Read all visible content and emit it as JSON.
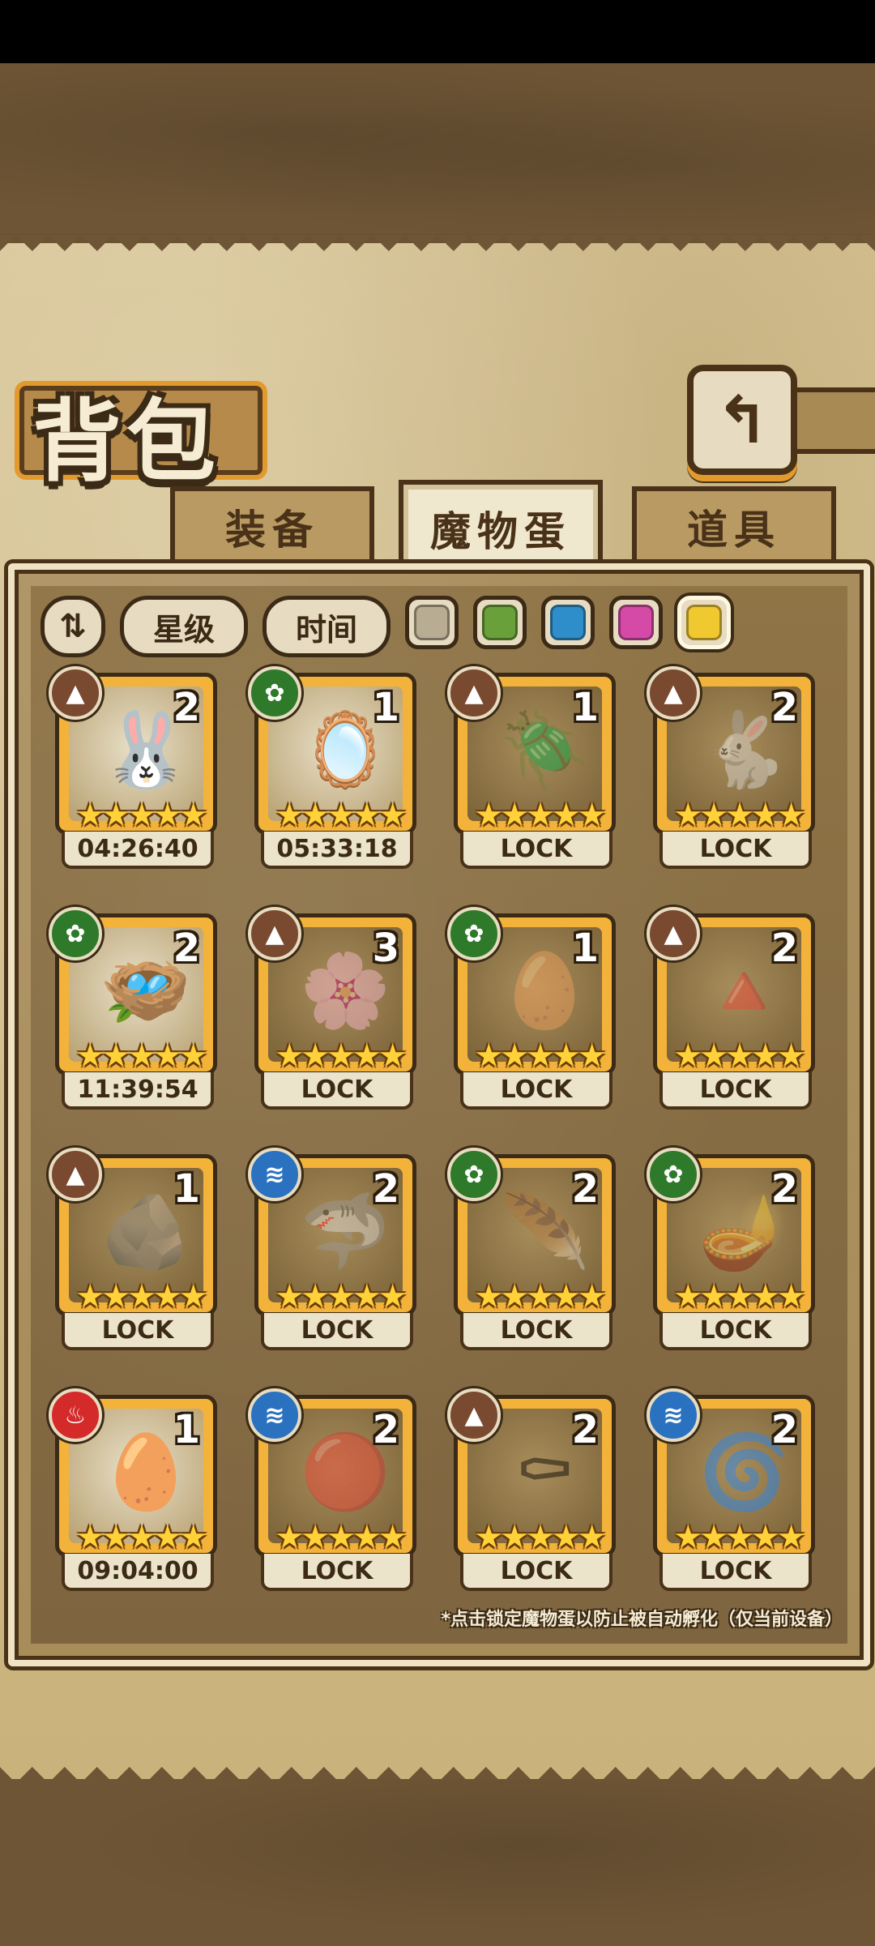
{
  "header": {
    "title": "背包",
    "back_icon": "↰"
  },
  "tabs": [
    {
      "label": "装备",
      "active": false
    },
    {
      "label": "魔物蛋",
      "active": true
    },
    {
      "label": "道具",
      "active": false
    }
  ],
  "filters": {
    "sort_icon": "⇅",
    "star_label": "星级",
    "time_label": "时间",
    "colors": [
      "#b8ad93",
      "#6aa03a",
      "#2e8ec9",
      "#d44aa6",
      "#f0c830"
    ]
  },
  "stars": "★★★★★",
  "eggs": [
    {
      "element": "earth",
      "count": "2",
      "label": "04:26:40",
      "glyph": "🐰",
      "locked": false
    },
    {
      "element": "wood",
      "count": "1",
      "label": "05:33:18",
      "glyph": "🪞",
      "locked": false
    },
    {
      "element": "earth",
      "count": "1",
      "label": "LOCK",
      "glyph": "🪲",
      "locked": true
    },
    {
      "element": "earth",
      "count": "2",
      "label": "LOCK",
      "glyph": "🐇",
      "locked": true
    },
    {
      "element": "wood",
      "count": "2",
      "label": "11:39:54",
      "glyph": "🪺",
      "locked": false
    },
    {
      "element": "earth",
      "count": "3",
      "label": "LOCK",
      "glyph": "🌸",
      "locked": true
    },
    {
      "element": "wood",
      "count": "1",
      "label": "LOCK",
      "glyph": "🥚",
      "locked": true
    },
    {
      "element": "earth",
      "count": "2",
      "label": "LOCK",
      "glyph": "🔺",
      "locked": true
    },
    {
      "element": "earth",
      "count": "1",
      "label": "LOCK",
      "glyph": "🪨",
      "locked": true
    },
    {
      "element": "water",
      "count": "2",
      "label": "LOCK",
      "glyph": "🦈",
      "locked": true
    },
    {
      "element": "wood",
      "count": "2",
      "label": "LOCK",
      "glyph": "🪶",
      "locked": true
    },
    {
      "element": "wood",
      "count": "2",
      "label": "LOCK",
      "glyph": "🪔",
      "locked": true
    },
    {
      "element": "fire",
      "count": "1",
      "label": "09:04:00",
      "glyph": "🥚",
      "locked": false
    },
    {
      "element": "water",
      "count": "2",
      "label": "LOCK",
      "glyph": "🔴",
      "locked": true
    },
    {
      "element": "earth",
      "count": "2",
      "label": "LOCK",
      "glyph": "⚰",
      "locked": true
    },
    {
      "element": "water",
      "count": "2",
      "label": "LOCK",
      "glyph": "🌀",
      "locked": true
    }
  ],
  "element_icons": {
    "earth": "▲",
    "wood": "✿",
    "water": "≋",
    "fire": "♨"
  },
  "footnote": "*点击锁定魔物蛋以防止被自动孵化（仅当前设备）"
}
